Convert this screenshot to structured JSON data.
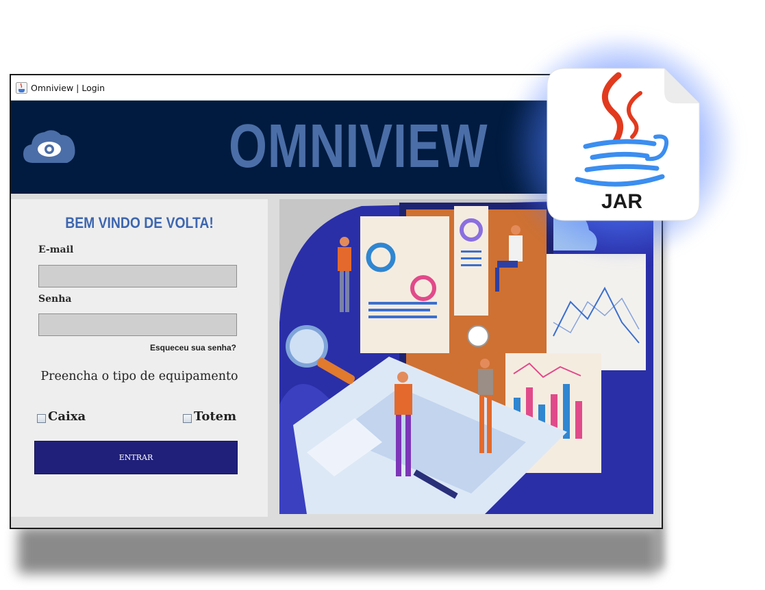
{
  "window": {
    "title": "Omniview | Login"
  },
  "banner": {
    "brand": "OMNIVIEW"
  },
  "login": {
    "welcome": "BEM VINDO DE VOLTA!",
    "email_label": "E-mail",
    "email_value": "",
    "password_label": "Senha",
    "password_value": "",
    "forgot_link": "Esqueceu sua senha?",
    "equipment_prompt": "Preencha o tipo de equipamento",
    "options": [
      {
        "label": "Caixa",
        "checked": false
      },
      {
        "label": "Totem",
        "checked": false
      }
    ],
    "submit_label": "ENTRAR"
  },
  "jar_badge": {
    "label": "JAR"
  },
  "icons": {
    "app": "java-cup-icon",
    "logo": "cloud-eye-icon",
    "badge": "java-jar-file-icon"
  },
  "colors": {
    "banner_bg": "#001b3f",
    "brand_text": "#4b6ea8",
    "welcome_text": "#3d66b0",
    "button_bg": "#20207a",
    "hero_bg": "#2a2fa8",
    "glow": "#5077ff"
  }
}
